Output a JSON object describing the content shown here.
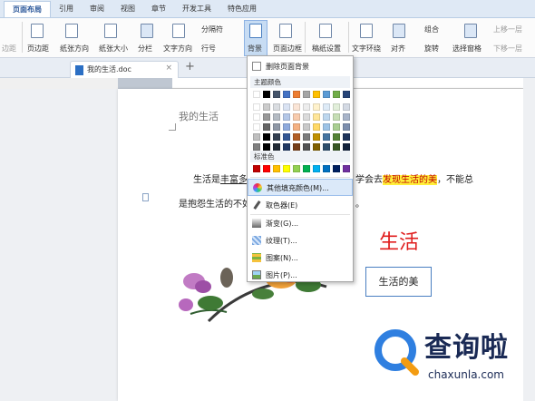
{
  "tabs": [
    "页面布局",
    "引用",
    "审阅",
    "视图",
    "章节",
    "开发工具",
    "特色应用"
  ],
  "ribbon": {
    "left_cut": "边距",
    "row1": [
      "页边距",
      "纸张方向",
      "纸张大小",
      "分栏",
      "文字方向",
      "分隔符",
      "背景",
      "页面边框",
      "稿纸设置",
      "文字环绕",
      "对齐",
      "组合",
      "上移一层"
    ],
    "row2": [
      "行号",
      "旋转",
      "选择窗格",
      "下移一层"
    ]
  },
  "document": {
    "tab_name": "我的生活.doc",
    "close": "×",
    "new_tab": "+",
    "header_text": "我的生活",
    "para1_a": "生活是",
    "para1_ul": "丰富多彩",
    "para1_b": "学会去",
    "para1_hl": "发现生活的美",
    "para1_c": "，不能总",
    "para2_a": "是抱怨生活的不如",
    "para2_b": "。",
    "title": "生活",
    "textbox": "生活的美"
  },
  "menu": {
    "remove_bg": "删除页面背景",
    "theme_colors": "主题颜色",
    "standard_colors": "标准色",
    "more_colors": "其他填充颜色(M)...",
    "eyedropper": "取色器(E)",
    "gradient": "渐变(G)...",
    "texture": "纹理(T)...",
    "pattern": "图案(N)...",
    "picture": "图片(P)..."
  },
  "colors": {
    "theme_row": [
      "#ffffff",
      "#000000",
      "#44546a",
      "#4472c4",
      "#ed7d31",
      "#a5a5a5",
      "#ffc000",
      "#5b9bd5",
      "#70ad47",
      "#264478"
    ],
    "standard": [
      "#c00000",
      "#ff0000",
      "#ffc000",
      "#ffff00",
      "#92d050",
      "#00b050",
      "#00b0f0",
      "#0070c0",
      "#002060",
      "#7030a0"
    ]
  },
  "watermark": {
    "brand": "查询啦",
    "domain": "chaxunla.com"
  }
}
